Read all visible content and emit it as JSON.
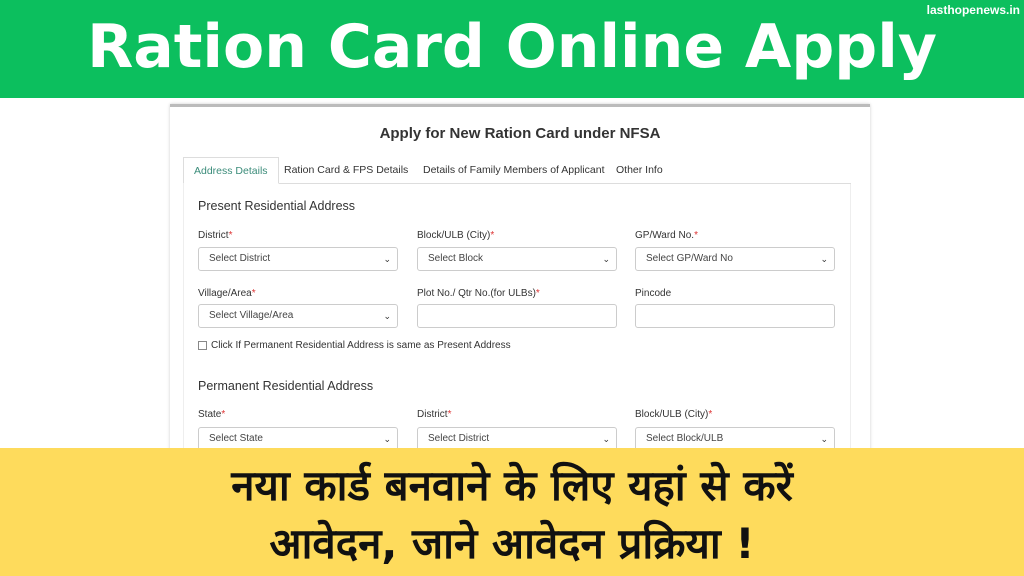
{
  "banner": {
    "title": "Ration Card Online Apply",
    "site": "lasthopenews.in",
    "hindi_line1": "नया कार्ड बनवाने के लिए यहां से करें",
    "hindi_line2": "आवेदन, जाने आवेदन प्रक्रिया !",
    "colors": {
      "green": "#0cbf5e",
      "yellow": "#fedb5c"
    }
  },
  "form": {
    "title": "Apply for New Ration Card under NFSA",
    "tabs": [
      {
        "label": "Address Details",
        "active": true
      },
      {
        "label": "Ration Card & FPS Details"
      },
      {
        "label": "Details of Family Members of Applicant"
      },
      {
        "label": "Other Info"
      }
    ],
    "present": {
      "heading": "Present Residential Address",
      "district": {
        "label": "District",
        "value": "Select District"
      },
      "block": {
        "label": "Block/ULB (City)",
        "value": "Select Block"
      },
      "ward": {
        "label": "GP/Ward No.",
        "value": "Select GP/Ward No"
      },
      "village": {
        "label": "Village/Area",
        "value": "Select Village/Area"
      },
      "plot": {
        "label": "Plot No./ Qtr No.(for ULBs)",
        "value": ""
      },
      "pincode": {
        "label": "Pincode",
        "value": ""
      }
    },
    "same_checkbox": "Click If Permanent Residential Address is same as Present Address",
    "permanent": {
      "heading": "Permanent Residential Address",
      "state": {
        "label": "State",
        "value": "Select State"
      },
      "district": {
        "label": "District",
        "value": "Select District"
      },
      "block": {
        "label": "Block/ULB (City)",
        "value": "Select Block/ULB"
      }
    }
  }
}
